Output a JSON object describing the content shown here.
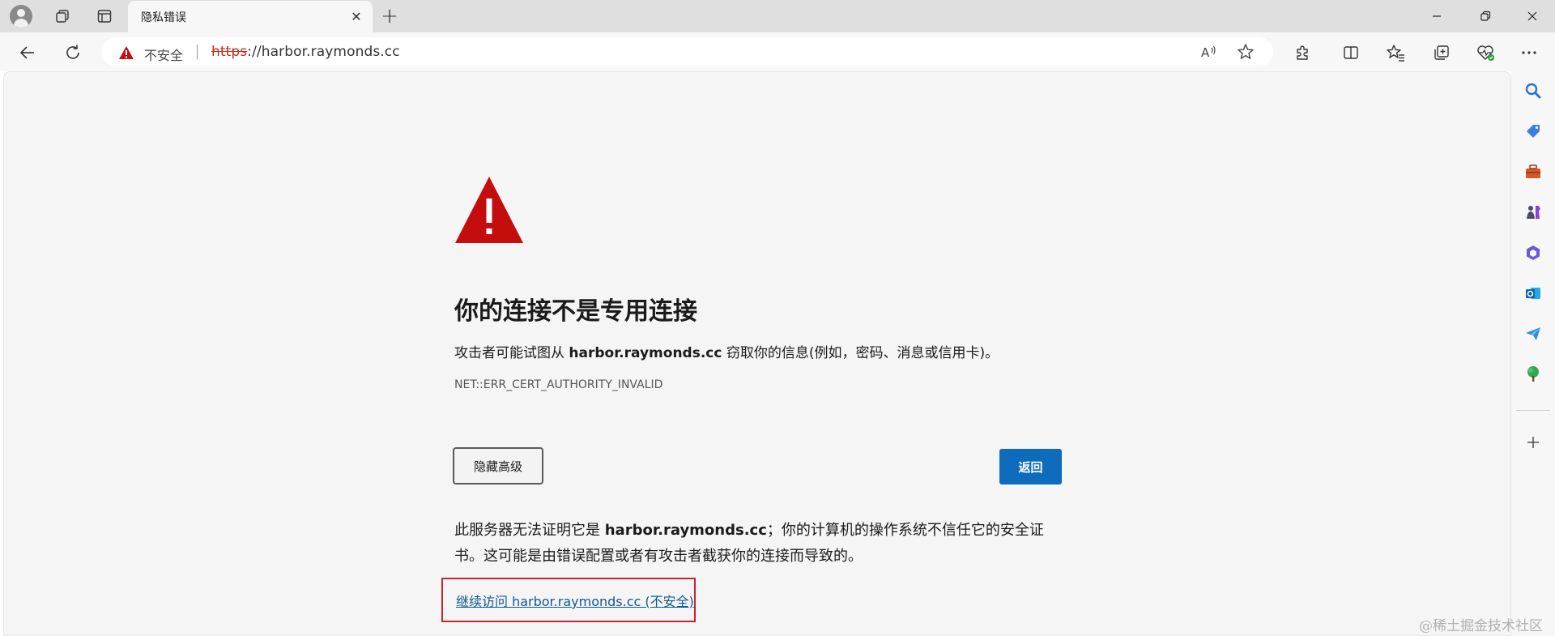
{
  "window": {
    "tab_title": "隐私错误",
    "tab_close_glyph": "✕",
    "new_tab_glyph": "+"
  },
  "address_bar": {
    "security_label": "不安全",
    "url_scheme": "https",
    "url_rest": "://harbor.raymonds.cc"
  },
  "page": {
    "heading": "你的连接不是专用连接",
    "desc_prefix": "攻击者可能试图从 ",
    "desc_host": "harbor.raymonds.cc",
    "desc_suffix": " 窃取你的信息(例如，密码、消息或信用卡)。",
    "error_code": "NET::ERR_CERT_AUTHORITY_INVALID",
    "hide_advanced_button": "隐藏高级",
    "back_button": "返回",
    "detail_prefix": "此服务器无法证明它是 ",
    "detail_host": "harbor.raymonds.cc",
    "detail_suffix": "；你的计算机的操作系统不信任它的安全证书。这可能是由错误配置或者有攻击者截获你的连接而导致的。",
    "proceed_link": "继续访问 harbor.raymonds.cc (不安全)"
  },
  "watermark": "@稀土掘金技术社区",
  "colors": {
    "warning_red": "#c40e0e",
    "link_blue": "#0f5796",
    "button_blue": "#0f6cbd",
    "highlight_border": "#c4262e"
  },
  "icons": {
    "toolbar": [
      "back-arrow-icon",
      "refresh-icon",
      "read-aloud-icon",
      "favorite-star-icon",
      "extensions-icon",
      "split-screen-icon",
      "favorites-icon",
      "collections-icon",
      "browser-essentials-icon",
      "more-icon"
    ],
    "sidebar": [
      "search-icon",
      "shopping-tag-icon",
      "tools-icon",
      "games-icon",
      "office-icon",
      "outlook-icon",
      "send-icon",
      "tree-icon",
      "add-icon"
    ]
  }
}
